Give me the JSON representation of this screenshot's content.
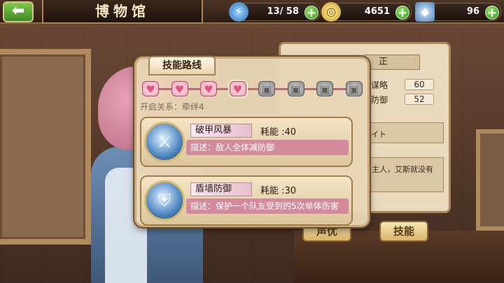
{
  "topbar": {
    "back_icon": "back-arrow-icon",
    "title": "博物馆",
    "energy": {
      "icon": "lightning-icon",
      "value": "13/ 58"
    },
    "gold": {
      "icon": "coin-icon",
      "value": "4651"
    },
    "gems": {
      "icon": "crystal-icon",
      "value": "96"
    }
  },
  "info_panel": {
    "title_fragment": "正",
    "stats": [
      {
        "label": "谋略",
        "value": "60"
      },
      {
        "label": "防御",
        "value": "52"
      }
    ],
    "text_fragment": "イト",
    "story_fragment": "主人，艾斯就没有",
    "buttons": {
      "voice": "声优",
      "skill": "技能"
    }
  },
  "modal": {
    "tab_title": "技能路线",
    "path": {
      "total_nodes": 8,
      "unlocked_nodes": 4,
      "current_node": 4
    },
    "unlock_label": "开启关系：牵绊4",
    "skills": [
      {
        "icon": "armor-break-icon",
        "name": "破甲风暴",
        "cost": "耗能 :40",
        "desc": "描述：敌人全体减防御"
      },
      {
        "icon": "shield-icon",
        "name": "盾墙防御",
        "cost": "耗能 :30",
        "desc": "描述：保护一个队友受到的5次单体伤害"
      }
    ]
  },
  "colors": {
    "accent_gold": "#d9b46a",
    "heart_active": "#e4557e",
    "desc_bg": "#d38a9c"
  }
}
